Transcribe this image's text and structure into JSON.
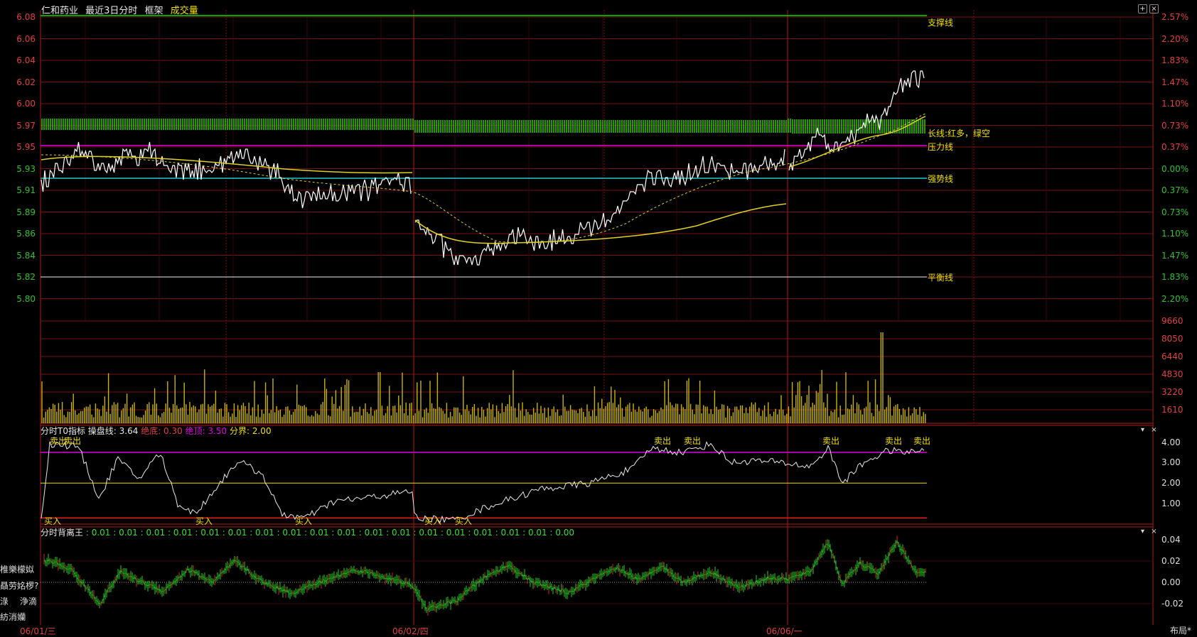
{
  "header": {
    "stock_name": "仁和药业",
    "period": "最近3日分时",
    "frame": "框架",
    "volume_label": "成交量"
  },
  "colors": {
    "up": "#e04040",
    "down": "#30c030",
    "support": "#00e000",
    "pressure": "#e000e0",
    "strong": "#20c8d0",
    "balance": "#f0f0f0",
    "price": "#ffffff",
    "avg": "#e0d020",
    "volume": "#c8b400"
  },
  "price_axis_left": [
    "6.08",
    "6.06",
    "6.04",
    "6.02",
    "6.00",
    "5.97",
    "5.95",
    "5.93",
    "5.91",
    "5.89",
    "5.86",
    "5.84",
    "5.82",
    "5.80"
  ],
  "price_axis_right": [
    "2.57%",
    "2.20%",
    "1.83%",
    "1.47%",
    "1.10%",
    "0.73%",
    "0.37%",
    "0.00%",
    "0.37%",
    "0.73%",
    "1.10%",
    "1.47%",
    "1.83%",
    "2.20%"
  ],
  "volume_axis": [
    "9660",
    "8050",
    "6440",
    "4830",
    "3220",
    "1610"
  ],
  "line_labels": {
    "support": "支撑线",
    "long_line": "长线:红多，绿空",
    "pressure": "压力线",
    "strong": "强势线",
    "balance": "平衡线"
  },
  "indicator1": {
    "name": "分时T0指标",
    "params": [
      {
        "label": "操盘线: 3.64",
        "color": "#e8e8e8"
      },
      {
        "label": "绝底: 0.30",
        "color": "#e04040"
      },
      {
        "label": "绝顶: 3.50",
        "color": "#e000e0"
      },
      {
        "label": "分界: 2.00",
        "color": "#f0e000"
      }
    ],
    "axis": [
      "4.00",
      "3.00",
      "2.00",
      "1.00"
    ],
    "sell_label": "卖出",
    "buy_label": "买入"
  },
  "indicator2": {
    "name": "分时背离王",
    "values": ": 0.01 : 0.01 : 0.01 : 0.01 : 0.01 : 0.01 : 0.01 : 0.01 : 0.01 : 0.01 : 0.01 : 0.01 : 0.01 : 0.01 : 0.01 : 0.01 : 0.01 : 0.00",
    "axis": [
      "0.04",
      "0.02",
      "0.00",
      "-0.02"
    ]
  },
  "side_labels": [
    "椎樂檬姒",
    "贔劳姳椤?",
    "淥　 浄滴",
    "紡消孏"
  ],
  "dates": [
    "06/01/三",
    "06/02/四",
    "06/06/一"
  ],
  "layout_button": "布局*"
}
